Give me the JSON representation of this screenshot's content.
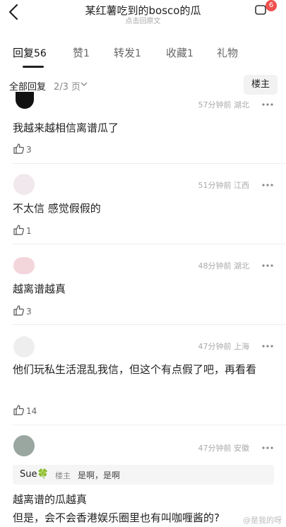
{
  "header": {
    "title": "某红薯吃到的bosco的瓜",
    "subtitle": "点击回原文",
    "badge": "6"
  },
  "tabs": [
    {
      "label": "回复",
      "count": "56"
    },
    {
      "label": "赞",
      "count": "1"
    },
    {
      "label": "转发",
      "count": "1"
    },
    {
      "label": "收藏",
      "count": "1"
    },
    {
      "label": "礼物",
      "count": ""
    }
  ],
  "filter": {
    "label": "全部回复",
    "page": "2/3 页",
    "owner_button": "楼主"
  },
  "comments": [
    {
      "meta": "57分钟前 湖北",
      "text": "我越来越相信离谱瓜了",
      "likes": "3"
    },
    {
      "meta": "51分钟前 江西",
      "text": "不太信  感觉假假的",
      "likes": "1"
    },
    {
      "meta": "48分钟前 湖北",
      "text": "越离谱越真",
      "likes": "3"
    },
    {
      "meta": "47分钟前 上海",
      "text": "他们玩私生活混乱我信，但这个有点假了吧，再看看",
      "likes": "14"
    },
    {
      "meta": "47分钟前 安徽",
      "text_1": "越离谱的瓜越真",
      "text_2": "但是，会不会香港娱乐圈里也有叫咖喱酱的?"
    }
  ],
  "reply": {
    "name": "Sue🍀",
    "tag": "楼主",
    "text": "是啊，是啊"
  },
  "watermark": "@是我的呀"
}
